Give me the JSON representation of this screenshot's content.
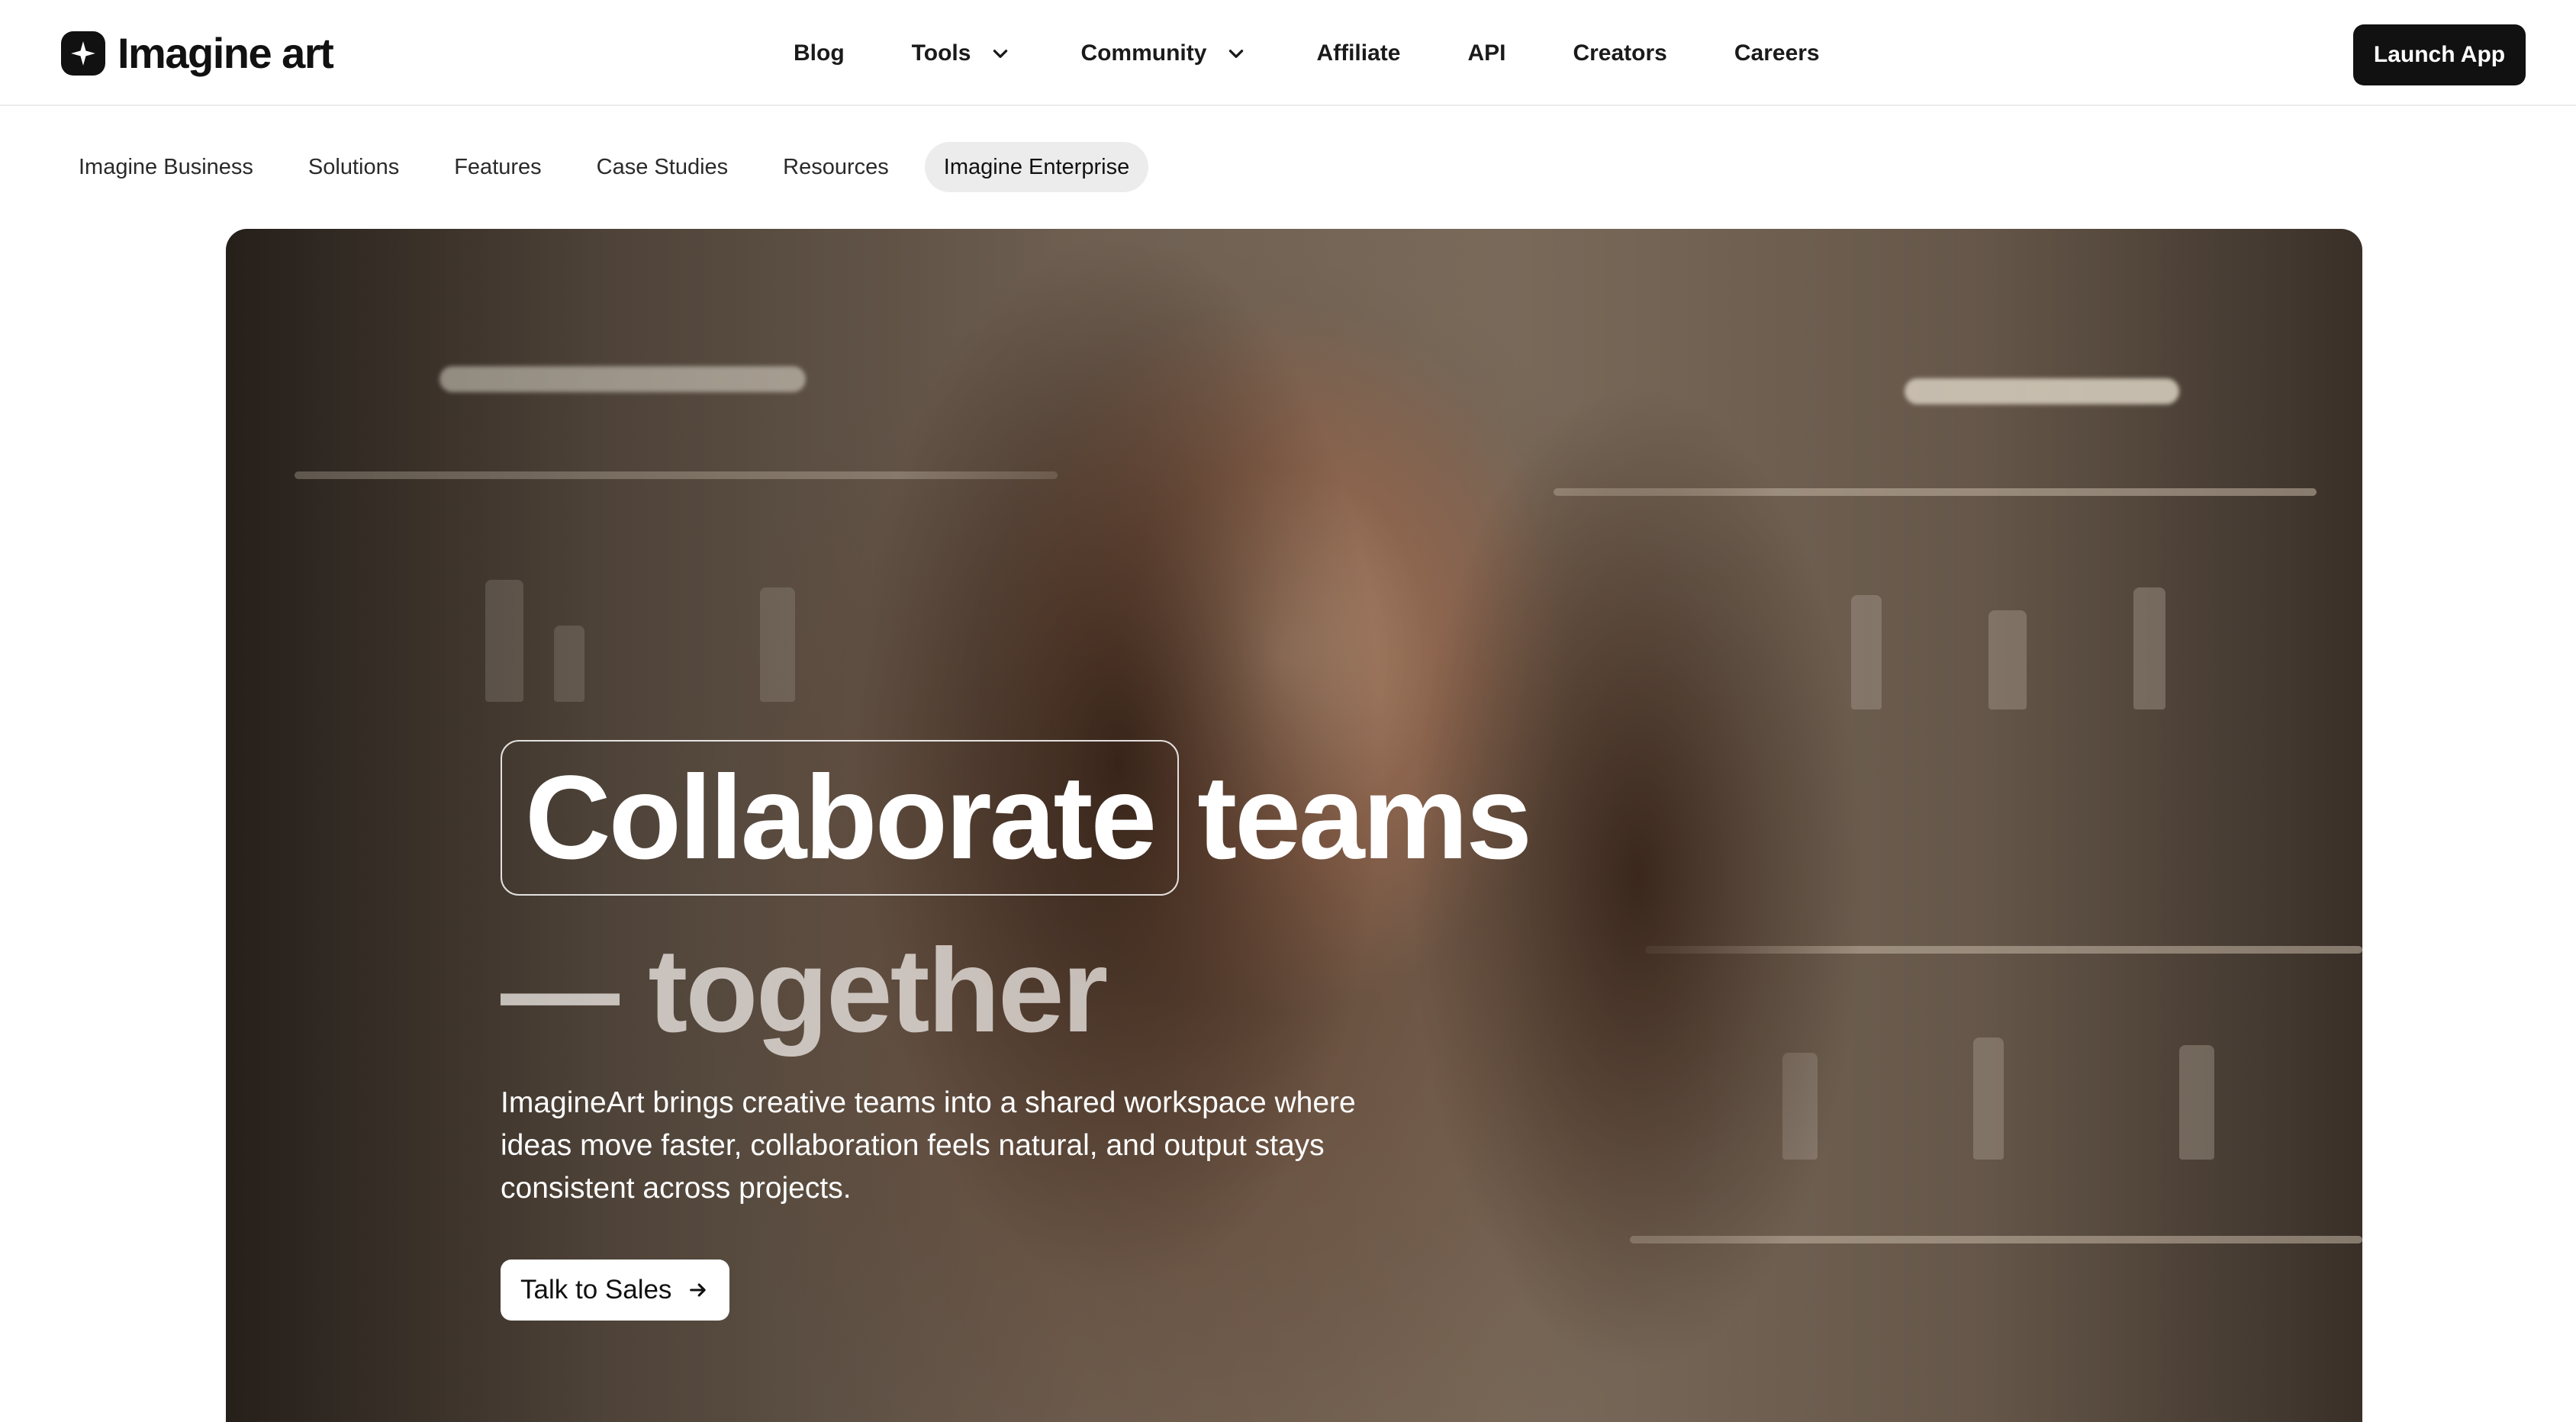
{
  "brand": {
    "name": "Imagine art"
  },
  "nav": {
    "items": [
      {
        "label": "Blog",
        "has_dropdown": false
      },
      {
        "label": "Tools",
        "has_dropdown": true
      },
      {
        "label": "Community",
        "has_dropdown": true
      },
      {
        "label": "Affiliate",
        "has_dropdown": false
      },
      {
        "label": "API",
        "has_dropdown": false
      },
      {
        "label": "Creators",
        "has_dropdown": false
      },
      {
        "label": "Careers",
        "has_dropdown": false
      }
    ],
    "launch_label": "Launch App"
  },
  "subnav": {
    "items": [
      {
        "label": "Imagine Business",
        "active": false
      },
      {
        "label": "Solutions",
        "active": false
      },
      {
        "label": "Features",
        "active": false
      },
      {
        "label": "Case Studies",
        "active": false
      },
      {
        "label": "Resources",
        "active": false
      },
      {
        "label": "Imagine Enterprise",
        "active": true
      }
    ]
  },
  "hero": {
    "headline_highlight": "Collaborate",
    "headline_rest": "teams",
    "headline_line2": "— together",
    "description": "ImagineArt brings creative teams into a shared workspace where ideas move faster, collaboration feels natural, and output stays consistent across projects.",
    "cta_label": "Talk to Sales"
  },
  "icons": {
    "logo": "sparkle-logo-icon",
    "dropdown": "chevron-down-icon",
    "cta": "arrow-right-icon"
  },
  "colors": {
    "primary": "#111111",
    "subnav_active_bg": "#ececec",
    "hero_text": "#ffffff"
  }
}
